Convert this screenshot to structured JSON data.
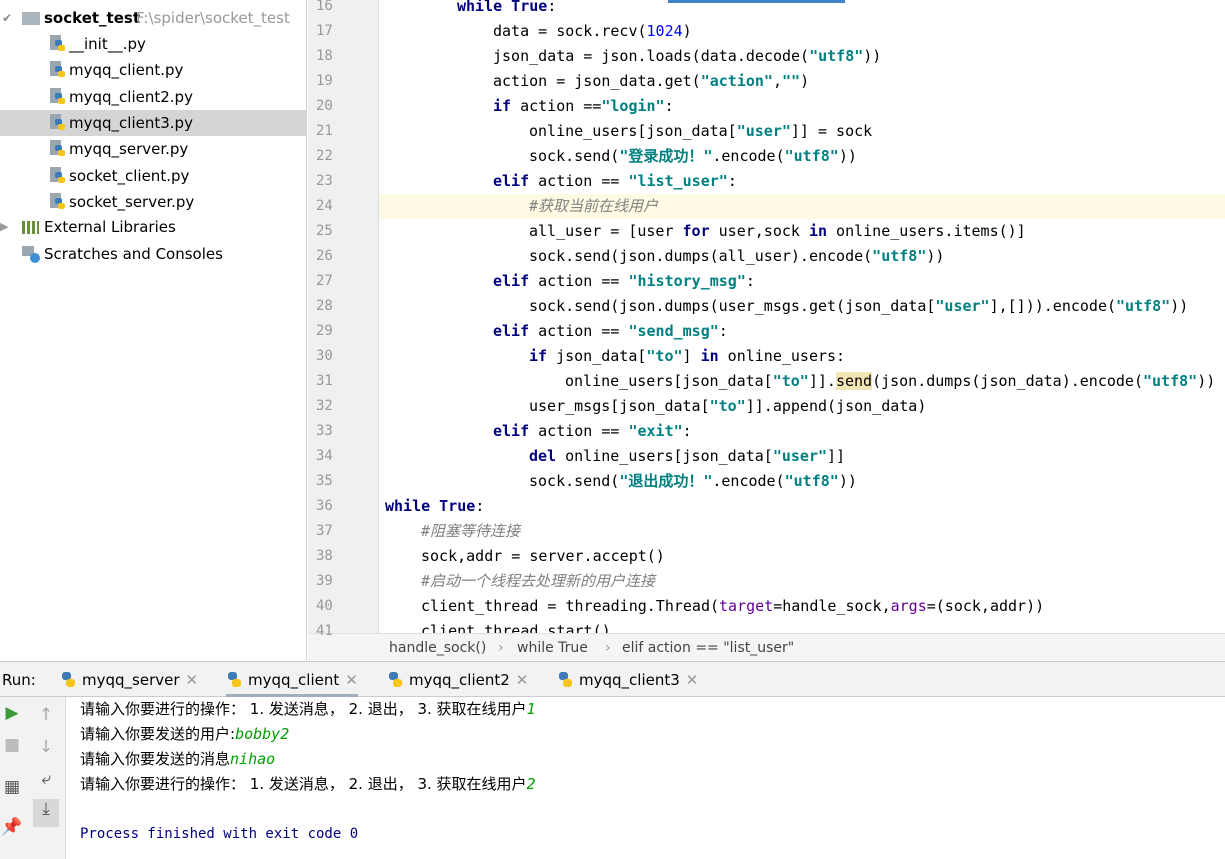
{
  "project": {
    "name": "socket_test",
    "path": "F:\\spider\\socket_test",
    "files": [
      "__init__.py",
      "myqq_client.py",
      "myqq_client2.py",
      "myqq_client3.py",
      "myqq_server.py",
      "socket_client.py",
      "socket_server.py"
    ],
    "selected_file": "myqq_client3.py",
    "external_libraries": "External Libraries",
    "scratches": "Scratches and Consoles"
  },
  "editor": {
    "first_line": 16,
    "current_line": 24,
    "lines": [
      [
        [
          2,
          "kw",
          "while True"
        ],
        [
          0,
          "",
          ":"
        ]
      ],
      [
        [
          3,
          "",
          "data = sock.recv("
        ],
        [
          0,
          "num",
          "1024"
        ],
        [
          0,
          "",
          ")"
        ]
      ],
      [
        [
          3,
          "",
          "json_data = json.loads(data.decode("
        ],
        [
          0,
          "str",
          "\"utf8\""
        ],
        [
          0,
          "",
          "))"
        ]
      ],
      [
        [
          3,
          "",
          "action = json_data.get("
        ],
        [
          0,
          "str",
          "\"action\""
        ],
        [
          0,
          "",
          ","
        ],
        [
          0,
          "str",
          "\"\""
        ],
        [
          0,
          "",
          ")"
        ]
      ],
      [
        [
          3,
          "kw",
          "if"
        ],
        [
          0,
          "",
          " action =="
        ],
        [
          0,
          "str",
          "\"login\""
        ],
        [
          0,
          "",
          ":"
        ]
      ],
      [
        [
          4,
          "",
          "online_users[json_data["
        ],
        [
          0,
          "str",
          "\"user\""
        ],
        [
          0,
          "",
          "]] = sock"
        ]
      ],
      [
        [
          4,
          "",
          "sock.send("
        ],
        [
          0,
          "str",
          "\"登录成功！\""
        ],
        [
          0,
          "",
          ".encode("
        ],
        [
          0,
          "str",
          "\"utf8\""
        ],
        [
          0,
          "",
          "))"
        ]
      ],
      [
        [
          3,
          "kw",
          "elif"
        ],
        [
          0,
          "",
          " action == "
        ],
        [
          0,
          "str",
          "\"list_user\""
        ],
        [
          0,
          "",
          ":"
        ]
      ],
      [
        [
          4,
          "cm",
          "#获取当前在线用户"
        ]
      ],
      [
        [
          4,
          "",
          "all_user = [user "
        ],
        [
          0,
          "kw",
          "for"
        ],
        [
          0,
          "",
          " user,sock "
        ],
        [
          0,
          "kw",
          "in"
        ],
        [
          0,
          "",
          " online_users.items()]"
        ]
      ],
      [
        [
          4,
          "",
          "sock.send(json.dumps(all_user).encode("
        ],
        [
          0,
          "str",
          "\"utf8\""
        ],
        [
          0,
          "",
          "))"
        ]
      ],
      [
        [
          3,
          "kw",
          "elif"
        ],
        [
          0,
          "",
          " action == "
        ],
        [
          0,
          "str",
          "\"history_msg\""
        ],
        [
          0,
          "",
          ":"
        ]
      ],
      [
        [
          4,
          "",
          "sock.send(json.dumps(user_msgs.get(json_data["
        ],
        [
          0,
          "str",
          "\"user\""
        ],
        [
          0,
          "",
          "],[])).encode("
        ],
        [
          0,
          "str",
          "\"utf8\""
        ],
        [
          0,
          "",
          "))"
        ]
      ],
      [
        [
          3,
          "kw",
          "elif"
        ],
        [
          0,
          "",
          " action == "
        ],
        [
          0,
          "str",
          "\"send_msg\""
        ],
        [
          0,
          "",
          ":"
        ]
      ],
      [
        [
          4,
          "kw",
          "if"
        ],
        [
          0,
          "",
          " json_data["
        ],
        [
          0,
          "str",
          "\"to\""
        ],
        [
          0,
          "",
          "] "
        ],
        [
          0,
          "kw",
          "in"
        ],
        [
          0,
          "",
          " online_users:"
        ]
      ],
      [
        [
          5,
          "",
          "online_users[json_data["
        ],
        [
          0,
          "str",
          "\"to\""
        ],
        [
          0,
          "",
          "]]."
        ],
        [
          0,
          "mt",
          "send"
        ],
        [
          0,
          "",
          "(json.dumps(json_data).encode("
        ],
        [
          0,
          "str",
          "\"utf8\""
        ],
        [
          0,
          "",
          "))"
        ]
      ],
      [
        [
          4,
          "",
          "user_msgs[json_data["
        ],
        [
          0,
          "str",
          "\"to\""
        ],
        [
          0,
          "",
          "]].append(json_data)"
        ]
      ],
      [
        [
          3,
          "kw",
          "elif"
        ],
        [
          0,
          "",
          " action == "
        ],
        [
          0,
          "str",
          "\"exit\""
        ],
        [
          0,
          "",
          ":"
        ]
      ],
      [
        [
          4,
          "kw",
          "del"
        ],
        [
          0,
          "",
          " online_users[json_data["
        ],
        [
          0,
          "str",
          "\"user\""
        ],
        [
          0,
          "",
          "]]"
        ]
      ],
      [
        [
          4,
          "",
          "sock.send("
        ],
        [
          0,
          "str",
          "\"退出成功！\""
        ],
        [
          0,
          "",
          ".encode("
        ],
        [
          0,
          "str",
          "\"utf8\""
        ],
        [
          0,
          "",
          "))"
        ]
      ],
      [
        [
          0,
          "kw",
          "while True"
        ],
        [
          0,
          "",
          ":"
        ]
      ],
      [
        [
          1,
          "cm",
          "#阻塞等待连接"
        ]
      ],
      [
        [
          1,
          "",
          "sock,addr = server.accept()"
        ]
      ],
      [
        [
          1,
          "cm",
          "#启动一个线程去处理新的用户连接"
        ]
      ],
      [
        [
          1,
          "",
          "client_thread = threading.Thread("
        ],
        [
          0,
          "ka",
          "target"
        ],
        [
          0,
          "",
          "=handle_sock,"
        ],
        [
          0,
          "ka",
          "args"
        ],
        [
          0,
          "",
          "=(sock,addr))"
        ]
      ],
      [
        [
          1,
          "",
          "client_thread.start()"
        ]
      ]
    ]
  },
  "breadcrumb": [
    "handle_sock()",
    "while True",
    "elif action == \"list_user\""
  ],
  "run": {
    "label": "Run:",
    "tabs": [
      "myqq_server",
      "myqq_client",
      "myqq_client2",
      "myqq_client3"
    ],
    "active_tab": "myqq_client"
  },
  "console": {
    "lines": [
      {
        "prompt": "请输入你要进行的操作： 1. 发送消息， 2. 退出， 3. 获取在线用户",
        "input": "1"
      },
      {
        "prompt": "请输入你要发送的用户:",
        "input": "bobby2"
      },
      {
        "prompt": "请输入你要发送的消息",
        "input": "nihao"
      },
      {
        "prompt": "请输入你要进行的操作： 1. 发送消息， 2. 退出， 3. 获取在线用户",
        "input": "2"
      }
    ],
    "exit_message": "Process finished with exit code 0"
  },
  "colors": {
    "keyword": "#000080",
    "string": "#008080",
    "number": "#0000ff",
    "comment": "#808080",
    "current_line": "#fffae3",
    "console_input": "#00a000"
  }
}
